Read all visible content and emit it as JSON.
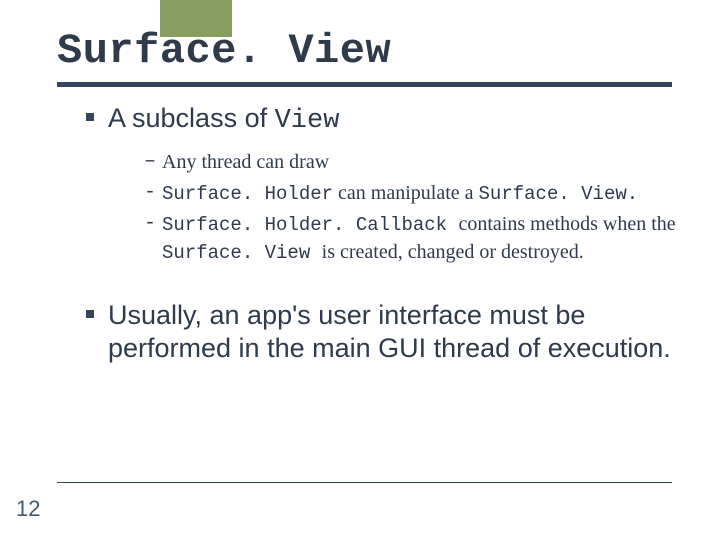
{
  "title": "Surface. View",
  "bullets": {
    "b0": {
      "pre": "A subclass of ",
      "code": "View"
    },
    "b1": "Usually, an app's user interface must be performed in the main GUI thread of execution."
  },
  "subs": {
    "s0": {
      "dash": "–",
      "text": "Any thread can draw"
    },
    "s1": {
      "dash": "-",
      "part1": "Surface. Holder",
      "part2": " can manipulate a ",
      "part3": "Surface. View."
    },
    "s2": {
      "dash": "-",
      "part1": "Surface. Holder. Callback ",
      "part2": " contains methods when the ",
      "part3": "Surface. View ",
      "part4": "is created, changed or destroyed."
    }
  },
  "page_number": "12"
}
